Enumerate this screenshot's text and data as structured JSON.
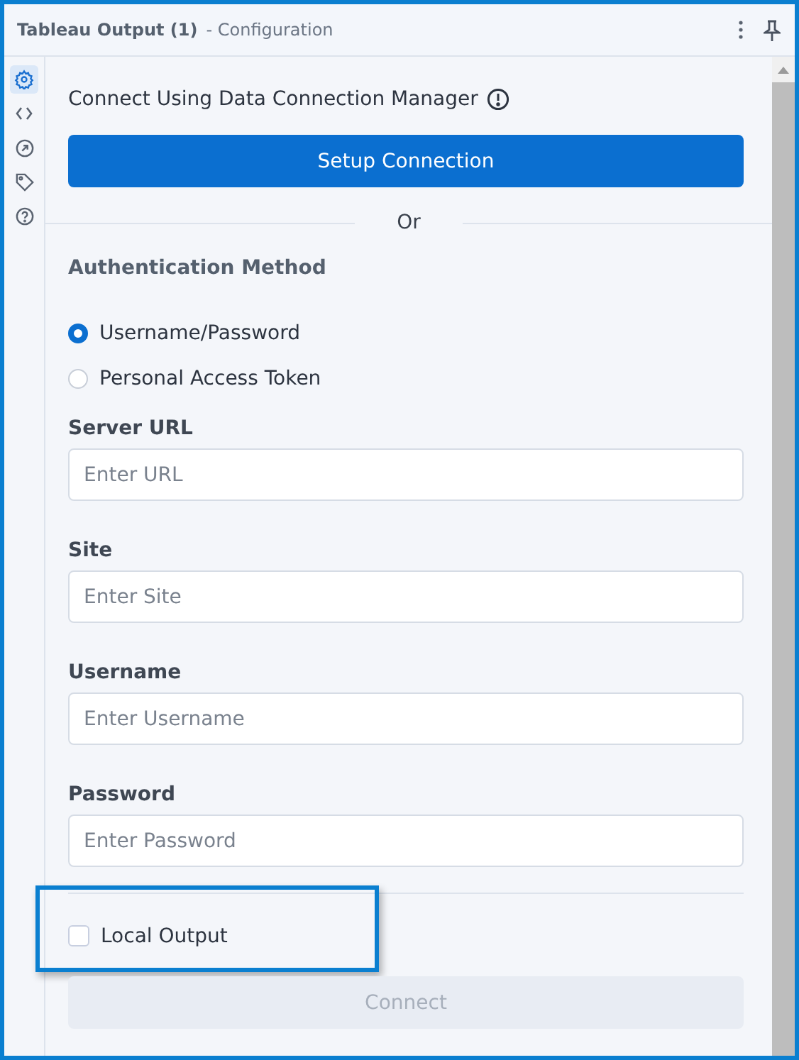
{
  "window": {
    "title": "Tableau Output (1)",
    "subtitle": "- Configuration"
  },
  "rail": [
    {
      "kind": "gear",
      "selected": true
    },
    {
      "kind": "code",
      "selected": false
    },
    {
      "kind": "arrow",
      "selected": false
    },
    {
      "kind": "tag",
      "selected": false
    },
    {
      "kind": "help",
      "selected": false
    }
  ],
  "connection": {
    "label": "Connect Using Data Connection Manager",
    "button": "Setup Connection",
    "separator": "Or"
  },
  "auth": {
    "title": "Authentication Method",
    "options": [
      {
        "label": "Username/Password",
        "selected": true
      },
      {
        "label": "Personal Access Token",
        "selected": false
      }
    ]
  },
  "fields": [
    {
      "label": "Server URL",
      "placeholder": "Enter URL"
    },
    {
      "label": "Site",
      "placeholder": "Enter Site"
    },
    {
      "label": "Username",
      "placeholder": "Enter Username"
    },
    {
      "label": "Password",
      "placeholder": "Enter Password"
    }
  ],
  "local_output": {
    "label": "Local Output",
    "checked": false,
    "highlighted": true
  },
  "connect": {
    "label": "Connect",
    "disabled": true
  }
}
